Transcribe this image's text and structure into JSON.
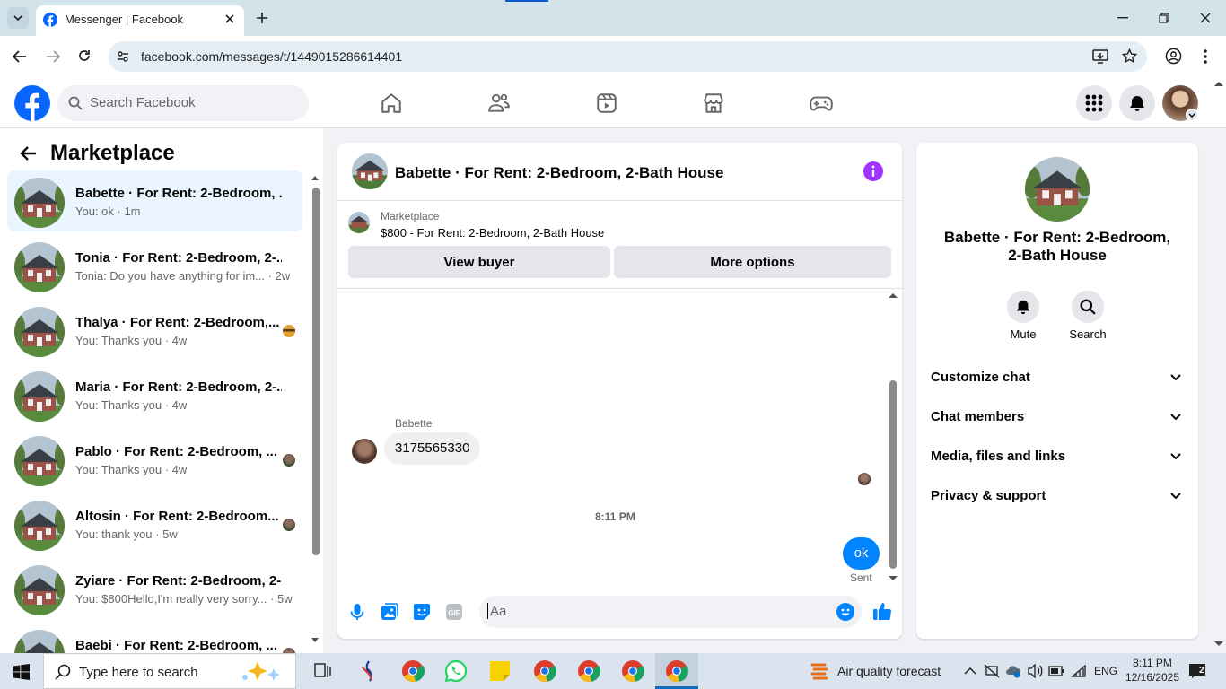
{
  "browser": {
    "tab_title": "Messenger | Facebook",
    "url": "facebook.com/messages/t/1449015286614401"
  },
  "fb_header": {
    "search_placeholder": "Search Facebook"
  },
  "left_panel": {
    "title": "Marketplace",
    "conversations": [
      {
        "name": "Babette · For Rent: 2-Bedroom, ...",
        "preview": "You: ok · 1m",
        "selected": true
      },
      {
        "name": "Tonia · For Rent: 2-Bedroom, 2-...",
        "preview": "Tonia: Do you have anything for im... · 2w"
      },
      {
        "name": "Thalya · For Rent: 2-Bedroom,...",
        "preview": "You: Thanks you · 4w"
      },
      {
        "name": "Maria · For Rent: 2-Bedroom, 2-...",
        "preview": "You: Thanks you · 4w"
      },
      {
        "name": "Pablo · For Rent: 2-Bedroom, ...",
        "preview": "You: Thanks you · 4w"
      },
      {
        "name": "Altosin · For Rent: 2-Bedroom...",
        "preview": "You: thank you · 5w"
      },
      {
        "name": "Zyiare · For Rent: 2-Bedroom, 2-...",
        "preview": "You: $800Hello,I'm really very sorry... · 5w"
      },
      {
        "name": "Baebi · For Rent: 2-Bedroom, ...",
        "preview": ""
      }
    ]
  },
  "chat": {
    "title": "Babette · For Rent: 2-Bedroom, 2-Bath House",
    "listing_source": "Marketplace",
    "listing": "$800 - For Rent: 2-Bedroom, 2-Bath House",
    "view_buyer": "View buyer",
    "more_options": "More options",
    "sender_name": "Babette",
    "message_received": "3175565330",
    "timestamp": "8:11 PM",
    "message_sent": "ok",
    "sent_status": "Sent",
    "composer_placeholder": "Aa"
  },
  "right_panel": {
    "title_line1": "Babette · For Rent: 2-Bedroom,",
    "title_line2": "2-Bath House",
    "mute": "Mute",
    "search": "Search",
    "sections": [
      "Customize chat",
      "Chat members",
      "Media, files and links",
      "Privacy & support"
    ]
  },
  "taskbar": {
    "search_placeholder": "Type here to search",
    "weather": "Air quality forecast",
    "lang": "ENG",
    "time": "8:11 PM",
    "date": "12/16/2025",
    "notification_count": "2"
  },
  "colors": {
    "fb_blue": "#0866ff",
    "messenger_blue": "#0084ff",
    "accent_purple": "#a033ff"
  }
}
